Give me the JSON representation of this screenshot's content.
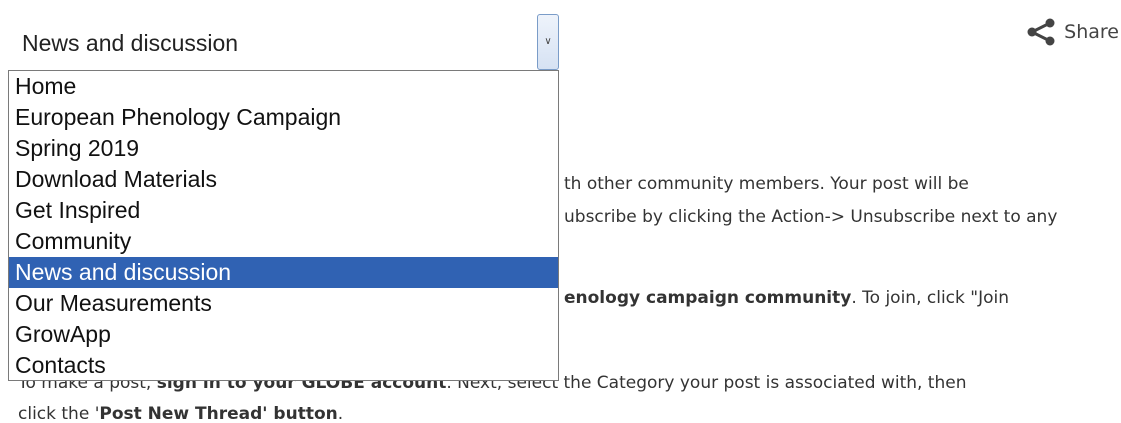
{
  "select": {
    "value": "News and discussion",
    "options": [
      "Home",
      "European Phenology Campaign",
      "Spring 2019",
      "Download Materials",
      "Get Inspired",
      "Community",
      "News and discussion",
      "Our Measurements",
      "GrowApp",
      "Contacts"
    ],
    "selected_index": 6,
    "arrow_icon": "chevron-down-icon"
  },
  "share": {
    "label": "Share",
    "icon": "share-icon"
  },
  "body": {
    "line1_tail": "th other community members. Your post will be",
    "line2_tail": "ubscribe by clicking the Action-> Unsubscribe next to any",
    "line3_bold": "enology campaign community",
    "line3_tail": ". To join, click \"Join",
    "line4_prefix": "To make a post, ",
    "line4_bold": "sign in to your GLOBE account",
    "line4_tail": ". Next, select the Category your post is associated with, then",
    "line5_prefix": "click the '",
    "line5_bold": "Post New Thread' button",
    "line5_tail": "."
  },
  "colors": {
    "selected_bg": "#3062b3",
    "text": "#333333"
  }
}
